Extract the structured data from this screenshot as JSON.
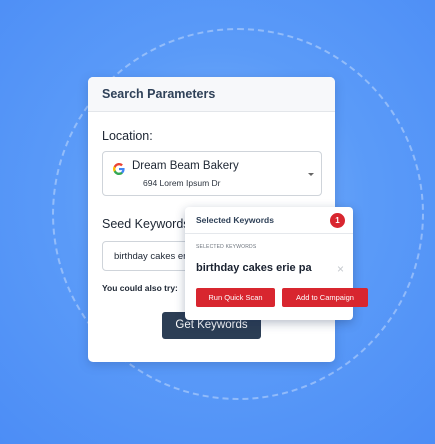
{
  "panel": {
    "title": "Search Parameters",
    "location_label": "Location:",
    "business_name": "Dream Beam Bakery",
    "business_address": "694 Lorem Ipsum Dr",
    "seed_label": "Seed Keywords",
    "seed_value": "birthday cakes erie pa",
    "also_try": "You could also try:",
    "get_button": "Get Keywords"
  },
  "popup": {
    "title": "Selected Keywords",
    "count": "1",
    "section_label": "SELECTED KEYWORDS",
    "keyword": "birthday cakes erie pa",
    "close": "×",
    "scan_button": "Run Quick Scan",
    "campaign_button": "Add to Campaign"
  },
  "icons": {
    "location_provider": "google-icon",
    "dropdown": "chevron-down-icon",
    "remove": "close-icon"
  },
  "colors": {
    "accent_red": "#d8262f",
    "navy": "#2c3e55",
    "background": "#5b9bf8"
  }
}
